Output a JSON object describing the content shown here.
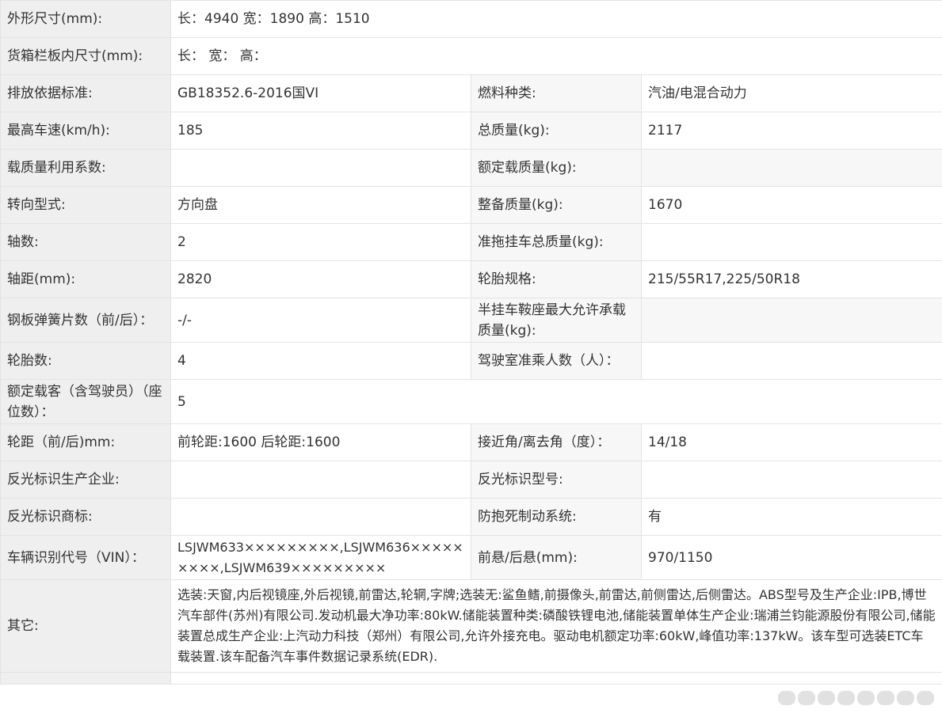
{
  "rows": {
    "dims": {
      "label": "外形尺寸(mm):",
      "value": "长：4940 宽：1890 高：1510"
    },
    "cargo": {
      "label": "货箱栏板内尺寸(mm):",
      "value": "长：  宽：  高："
    },
    "emission": {
      "label": "排放依据标准:",
      "value": "GB18352.6-2016国VI",
      "label2": "燃料种类:",
      "value2": "汽油/电混合动力"
    },
    "speed": {
      "label": "最高车速(km/h):",
      "value": "185",
      "label2": "总质量(kg):",
      "value2": "2117"
    },
    "loadcoef": {
      "label": "载质量利用系数:",
      "value": "",
      "label2": "额定载质量(kg):",
      "value2": ""
    },
    "steering": {
      "label": "转向型式:",
      "value": "方向盘",
      "label2": "整备质量(kg):",
      "value2": "1670"
    },
    "axles": {
      "label": "轴数:",
      "value": "2",
      "label2": "准拖挂车总质量(kg):",
      "value2": ""
    },
    "wheelbase": {
      "label": "轴距(mm):",
      "value": "2820",
      "label2": "轮胎规格:",
      "value2": "215/55R17,225/50R18"
    },
    "springs": {
      "label": "钢板弹簧片数（前/后）：",
      "value": "-/-",
      "label2": "半挂车鞍座最大允许承载质量(kg):",
      "value2": ""
    },
    "tires": {
      "label": "轮胎数:",
      "value": "4",
      "label2": "驾驶室准乘人数（人）：",
      "value2": ""
    },
    "seats": {
      "label": "额定载客（含驾驶员）（座位数）：",
      "value": "5"
    },
    "track": {
      "label": "轮距（前/后)mm:",
      "value": "前轮距:1600 后轮距:1600",
      "label2": "接近角/离去角（度）：",
      "value2": "14/18"
    },
    "reflector": {
      "label": "反光标识生产企业:",
      "value": "",
      "label2": "反光标识型号:",
      "value2": ""
    },
    "refbrand": {
      "label": "反光标识商标:",
      "value": "",
      "label2": "防抱死制动系统:",
      "value2": "有"
    },
    "vin": {
      "label": "车辆识别代号（VIN）：",
      "value": "LSJWM633×××××××××,LSJWM636×××××××××,LSJWM639×××××××××",
      "label2": "前悬/后悬(mm):",
      "value2": "970/1150"
    },
    "other": {
      "label": "其它:",
      "value": "选装:天窗,内后视镜座,外后视镜,前雷达,轮辋,字牌;选装无:鲨鱼鳍,前摄像头,前雷达,前侧雷达,后侧雷达。ABS型号及生产企业:IPB,博世汽车部件(苏州)有限公司.发动机最大净功率:80kW.储能装置种类:磷酸铁锂电池,储能装置单体生产企业:瑞浦兰钧能源股份有限公司,储能装置总成生产企业:上汽动力科技（郑州）有限公司,允许外接充电。驱动电机额定功率:60kW,峰值功率:137kW。该车型可选装ETC车载装置.该车配备汽车事件数据记录系统(EDR)."
    }
  }
}
